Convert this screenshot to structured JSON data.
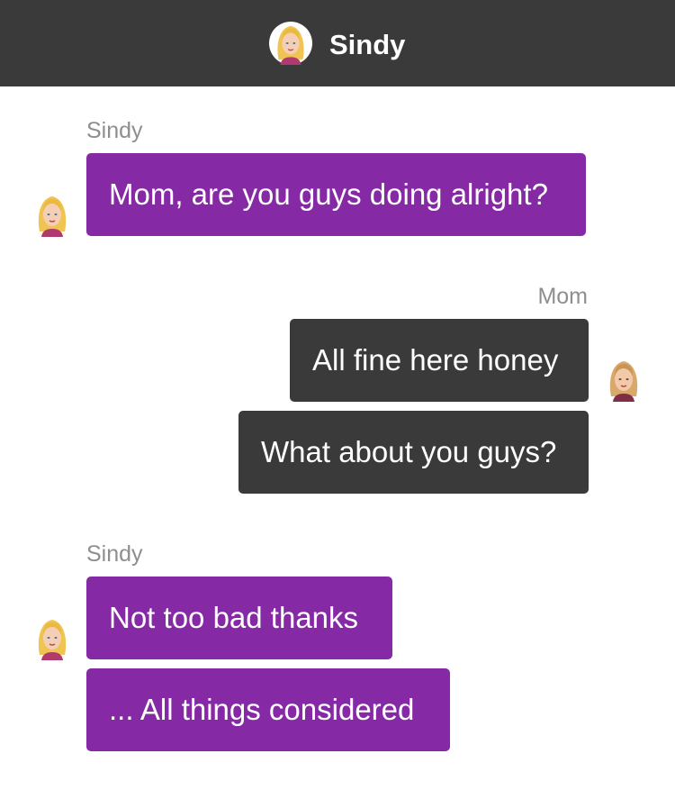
{
  "header": {
    "title": "Sindy",
    "avatar_icon": "sindy-avatar-icon"
  },
  "colors": {
    "header_bg": "#3a3a3a",
    "incoming_bubble": "#8629a5",
    "outgoing_bubble": "#3a3a3a",
    "sender_label": "#8e8e8e",
    "background": "#ffffff"
  },
  "messages": {
    "group1": {
      "sender": "Sindy",
      "bubbles": [
        "Mom, are you guys doing alright?"
      ]
    },
    "group2": {
      "sender": "Mom",
      "bubbles": [
        "All fine here honey",
        "What about you guys?"
      ]
    },
    "group3": {
      "sender": "Sindy",
      "bubbles": [
        "Not too bad thanks",
        "... All things considered"
      ]
    }
  }
}
